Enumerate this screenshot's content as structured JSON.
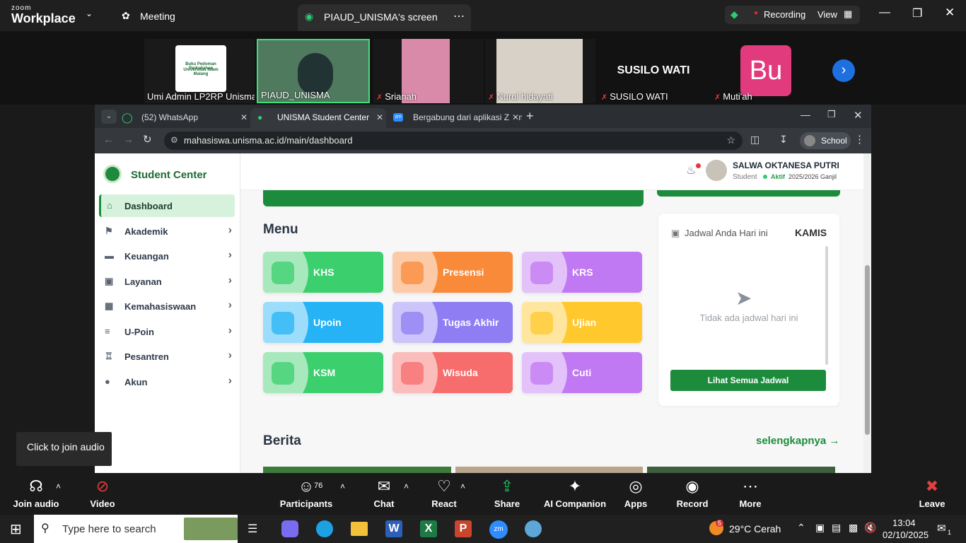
{
  "zoom": {
    "logo_top": "zoom",
    "logo_bottom": "Workplace",
    "meeting_label": "Meeting",
    "share_title": "PIAUD_UNISMA's screen",
    "recording_label": "Recording",
    "view_label": "View",
    "tooltip": "Click to join audio"
  },
  "gallery": [
    {
      "name": "Umi Admin LP2RP Unisma",
      "muted": false
    },
    {
      "name": "PIAUD_UNISMA",
      "muted": false
    },
    {
      "name": "Srianah",
      "muted": true
    },
    {
      "name": "Nurul hidayati",
      "muted": true
    },
    {
      "name": "SUSILO WATI",
      "muted": true,
      "display": "SUSILO WATI"
    },
    {
      "name": "Muti'ah",
      "muted": true,
      "avatar": "Bu"
    }
  ],
  "thumb_doc": {
    "line1": "Buku Pedoman Perkuliahan",
    "line2": "Universitas Islam Malang"
  },
  "browser": {
    "tabs": [
      {
        "label": "(52) WhatsApp"
      },
      {
        "label": "UNISMA Student Center"
      },
      {
        "label": "Bergabung dari aplikasi Zoom W"
      }
    ],
    "url": "mahasiswa.unisma.ac.id/main/dashboard",
    "profile": "School"
  },
  "site": {
    "brand": "Student Center",
    "sidebar": [
      {
        "label": "Dashboard",
        "icon": "home-icon"
      },
      {
        "label": "Akademik",
        "icon": "graduation-icon"
      },
      {
        "label": "Keuangan",
        "icon": "wallet-icon"
      },
      {
        "label": "Layanan",
        "icon": "box-icon"
      },
      {
        "label": "Kemahasiswaan",
        "icon": "calendar-icon"
      },
      {
        "label": "U-Poin",
        "icon": "sliders-icon"
      },
      {
        "label": "Pesantren",
        "icon": "building-icon"
      },
      {
        "label": "Akun",
        "icon": "user-icon"
      }
    ],
    "user": {
      "name": "SALWA OKTANESA PUTRI",
      "role": "Student",
      "status": "Aktif",
      "term": "2025/2026 Ganjil"
    },
    "menu_title": "Menu",
    "menu": [
      {
        "label": "KHS",
        "color": "#3ccf6e"
      },
      {
        "label": "Presensi",
        "color": "#f98a3a"
      },
      {
        "label": "KRS",
        "color": "#c178f3"
      },
      {
        "label": "Upoin",
        "color": "#25b3f5"
      },
      {
        "label": "Tugas Akhir",
        "color": "#8f7df3"
      },
      {
        "label": "Ujian",
        "color": "#ffc82c"
      },
      {
        "label": "KSM",
        "color": "#3ccf6e"
      },
      {
        "label": "Wisuda",
        "color": "#f76c6c"
      },
      {
        "label": "Cuti",
        "color": "#c178f3"
      }
    ],
    "schedule": {
      "title": "Jadwal Anda Hari ini",
      "day": "KAMIS",
      "empty": "Tidak ada jadwal hari ini",
      "button": "Lihat Semua Jadwal"
    },
    "news_title": "Berita",
    "news_more": "selengkapnya"
  },
  "toolbar": [
    {
      "label": "Join audio",
      "icon": "headphones-icon"
    },
    {
      "label": "Video",
      "icon": "video-off-icon"
    },
    {
      "label": "Participants",
      "icon": "participants-icon",
      "count": "76"
    },
    {
      "label": "Chat",
      "icon": "chat-icon"
    },
    {
      "label": "React",
      "icon": "react-icon"
    },
    {
      "label": "Share",
      "icon": "share-icon"
    },
    {
      "label": "AI Companion",
      "icon": "sparkle-icon"
    },
    {
      "label": "Apps",
      "icon": "apps-icon"
    },
    {
      "label": "Record",
      "icon": "record-icon"
    },
    {
      "label": "More",
      "icon": "more-icon"
    },
    {
      "label": "Leave",
      "icon": "leave-icon"
    }
  ],
  "taskbar": {
    "search_placeholder": "Type here to search",
    "weather": "29°C  Cerah",
    "weather_badge": "5",
    "time": "13:04",
    "date": "02/10/2025",
    "notif_count": "1"
  }
}
